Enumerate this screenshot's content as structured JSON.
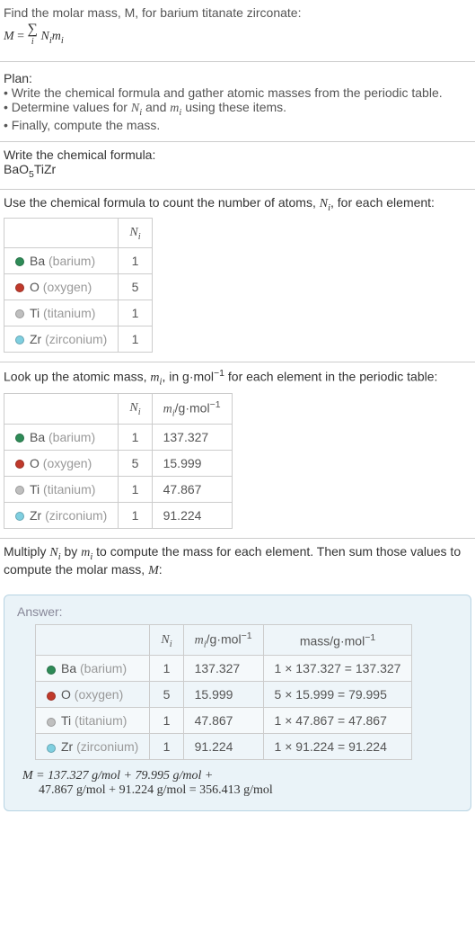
{
  "intro": {
    "line1": "Find the molar mass, M, for barium titanate zirconate:",
    "eq_lhs": "M",
    "eq_eq": " = ",
    "eq_sum": "∑",
    "eq_sub": "i",
    "eq_rhs1": " N",
    "eq_rhs1_sub": "i",
    "eq_rhs2": "m",
    "eq_rhs2_sub": "i"
  },
  "plan": {
    "title": "Plan:",
    "b1": "• Write the chemical formula and gather atomic masses from the periodic table.",
    "b2_a": "• Determine values for ",
    "b2_n": "N",
    "b2_nsub": "i",
    "b2_mid": " and ",
    "b2_m": "m",
    "b2_msub": "i",
    "b2_end": " using these items.",
    "b3": "• Finally, compute the mass."
  },
  "chemformula": {
    "title": "Write the chemical formula:",
    "p1": "BaO",
    "p1sub": "5",
    "p2": "TiZr"
  },
  "count": {
    "title_a": "Use the chemical formula to count the number of atoms, ",
    "title_n": "N",
    "title_nsub": "i",
    "title_b": ", for each element:",
    "hdr_n": "N",
    "hdr_nsub": "i"
  },
  "elements": [
    {
      "color": "#2e8b57",
      "sym": "Ba",
      "name": "(barium)",
      "n": "1",
      "m": "137.327",
      "mass": "1 × 137.327 = 137.327"
    },
    {
      "color": "#c0392b",
      "sym": "O",
      "name": "(oxygen)",
      "n": "5",
      "m": "15.999",
      "mass": "5 × 15.999 = 79.995"
    },
    {
      "color": "#bfbfbf",
      "sym": "Ti",
      "name": "(titanium)",
      "n": "1",
      "m": "47.867",
      "mass": "1 × 47.867 = 47.867"
    },
    {
      "color": "#7fcfe0",
      "sym": "Zr",
      "name": "(zirconium)",
      "n": "1",
      "m": "91.224",
      "mass": "1 × 91.224 = 91.224"
    }
  ],
  "lookup": {
    "title_a": "Look up the atomic mass, ",
    "title_m": "m",
    "title_msub": "i",
    "title_b": ", in g·mol",
    "title_exp": "−1",
    "title_c": " for each element in the periodic table:",
    "hdr_n": "N",
    "hdr_nsub": "i",
    "hdr_m": "m",
    "hdr_msub": "i",
    "hdr_unit": "/g·mol",
    "hdr_exp": "−1"
  },
  "multiply": {
    "a": "Multiply ",
    "n": "N",
    "nsub": "i",
    "b": " by ",
    "m": "m",
    "msub": "i",
    "c": " to compute the mass for each element. Then sum those values to compute the molar mass, ",
    "mm": "M",
    "d": ":"
  },
  "answer": {
    "title": "Answer:",
    "hdr_n": "N",
    "hdr_nsub": "i",
    "hdr_m": "m",
    "hdr_msub": "i",
    "hdr_munit": "/g·mol",
    "hdr_mexp": "−1",
    "hdr_mass": "mass/g·mol",
    "hdr_massexp": "−1",
    "final1": "M = 137.327 g/mol + 79.995 g/mol +",
    "final2": "47.867 g/mol + 91.224 g/mol = 356.413 g/mol"
  }
}
